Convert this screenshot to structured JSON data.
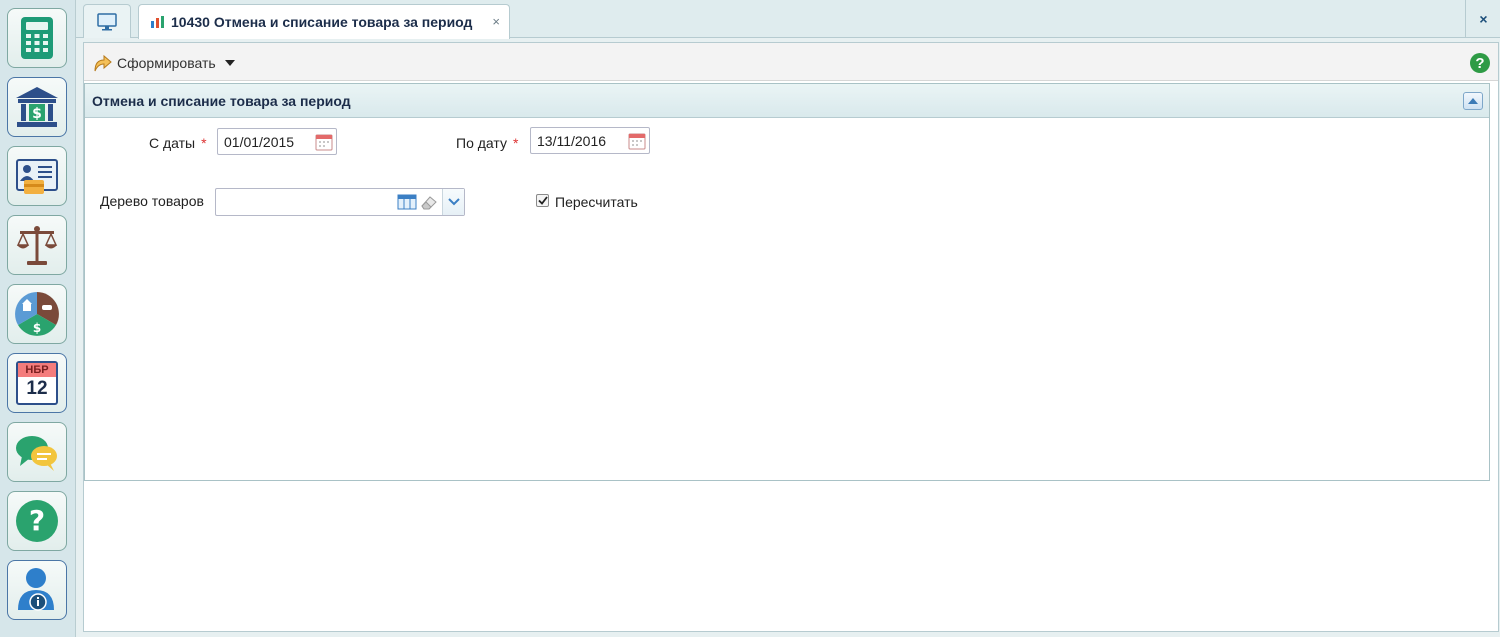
{
  "launcher": {
    "items": [
      {
        "name": "calculator"
      },
      {
        "name": "bank"
      },
      {
        "name": "id-card"
      },
      {
        "name": "scales"
      },
      {
        "name": "assets-pie"
      },
      {
        "name": "calendar",
        "top_text": "НБР",
        "number": "12"
      },
      {
        "name": "chat"
      },
      {
        "name": "help"
      },
      {
        "name": "user-info"
      }
    ]
  },
  "tabs": {
    "active_title": "10430 Отмена и списание товара за период",
    "close_glyph": "×",
    "window_close_glyph": "×"
  },
  "toolbar": {
    "form_label": "Сформировать",
    "help_glyph": "?"
  },
  "panel": {
    "title": "Отмена и списание товара за период",
    "from_label": "С даты",
    "from_value": "01/01/2015",
    "to_label": "По дату",
    "to_value": "13/11/2016",
    "required_mark": "*",
    "tree_label": "Дерево товаров",
    "tree_value": "",
    "recalc_label": "Пересчитать",
    "recalc_checked": true
  },
  "colors": {
    "accent_green": "#2e9b45",
    "header_text": "#1c2d4a",
    "required": "#dd3333"
  }
}
